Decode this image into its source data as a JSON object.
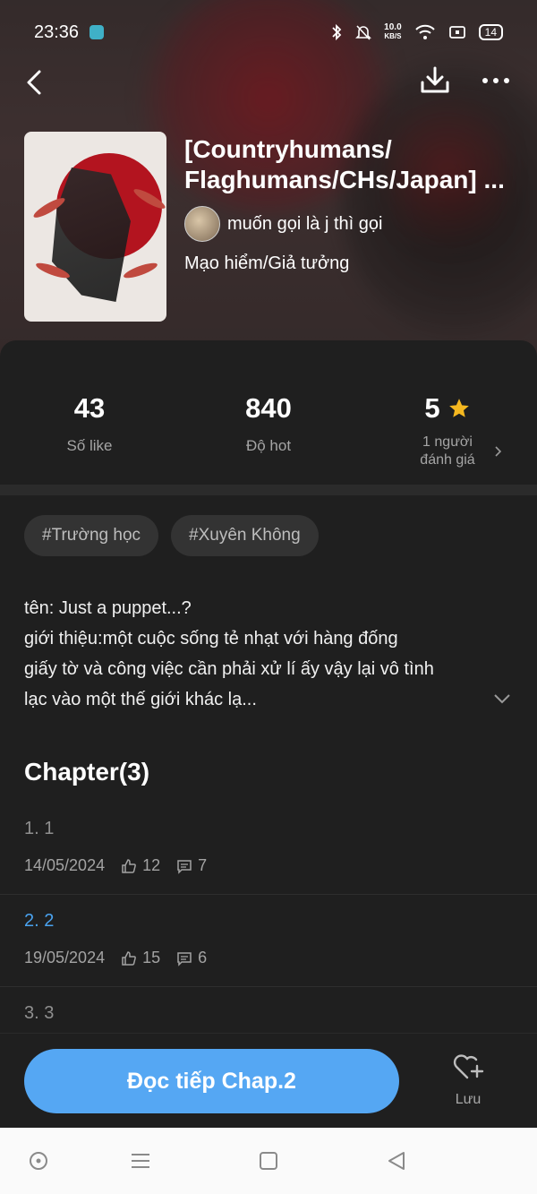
{
  "status_bar": {
    "time": "23:36",
    "net_speed_value": "10.0",
    "net_speed_unit": "KB/S",
    "battery": "14"
  },
  "book": {
    "title_line1": "[Countryhumans/",
    "title_line2": "Flaghumans/CHs/Japan] ...",
    "author": "muốn gọi là j thì gọi",
    "genre": "Mạo hiểm/Giả tưởng"
  },
  "stats": {
    "likes_value": "43",
    "likes_label": "Số like",
    "hot_value": "840",
    "hot_label": "Độ hot",
    "rating_value": "5",
    "rating_label_line1": "1 người",
    "rating_label_line2": "đánh giá"
  },
  "tags": [
    "#Trường học",
    "#Xuyên Không"
  ],
  "description": {
    "line1": "tên: Just a puppet...?",
    "line2": "giới thiệu:một cuộc sống tẻ nhạt với hàng đống",
    "line3": "giấy tờ và công việc cần phải xử lí ấy vậy lại vô tình",
    "line4": "lạc vào một thế giới khác lạ..."
  },
  "chapters_heading": "Chapter(3)",
  "chapters": [
    {
      "name": "1. 1",
      "date": "14/05/2024",
      "likes": "12",
      "comments": "7"
    },
    {
      "name": "2. 2",
      "date": "19/05/2024",
      "likes": "15",
      "comments": "6"
    },
    {
      "name": "3. 3"
    }
  ],
  "actions": {
    "read_label": "Đọc tiếp Chap.2",
    "save_label": "Lưu"
  },
  "colors": {
    "accent": "#55a7f3",
    "current_chapter": "#4aa3f0",
    "star": "#f5b820",
    "background": "#1f1f1f"
  }
}
